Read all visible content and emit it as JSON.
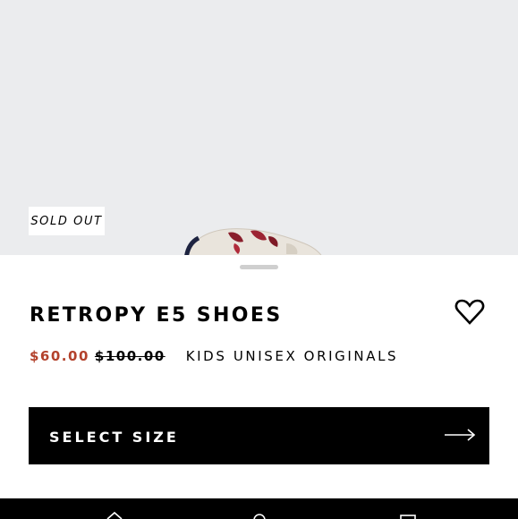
{
  "product": {
    "badge": "SOLD OUT",
    "title": "RETROPY E5 SHOES",
    "sale_price": "$60.00",
    "original_price": "$100.00",
    "category": "KIDS UNISEX ORIGINALS"
  },
  "actions": {
    "select_size_label": "SELECT SIZE"
  },
  "icons": {
    "wishlist": "heart-outline-icon",
    "cta_arrow": "long-arrow-right-icon"
  },
  "colors": {
    "hero_bg": "#ebecee",
    "sale_price": "#b3412b",
    "cta_bg": "#000000"
  }
}
